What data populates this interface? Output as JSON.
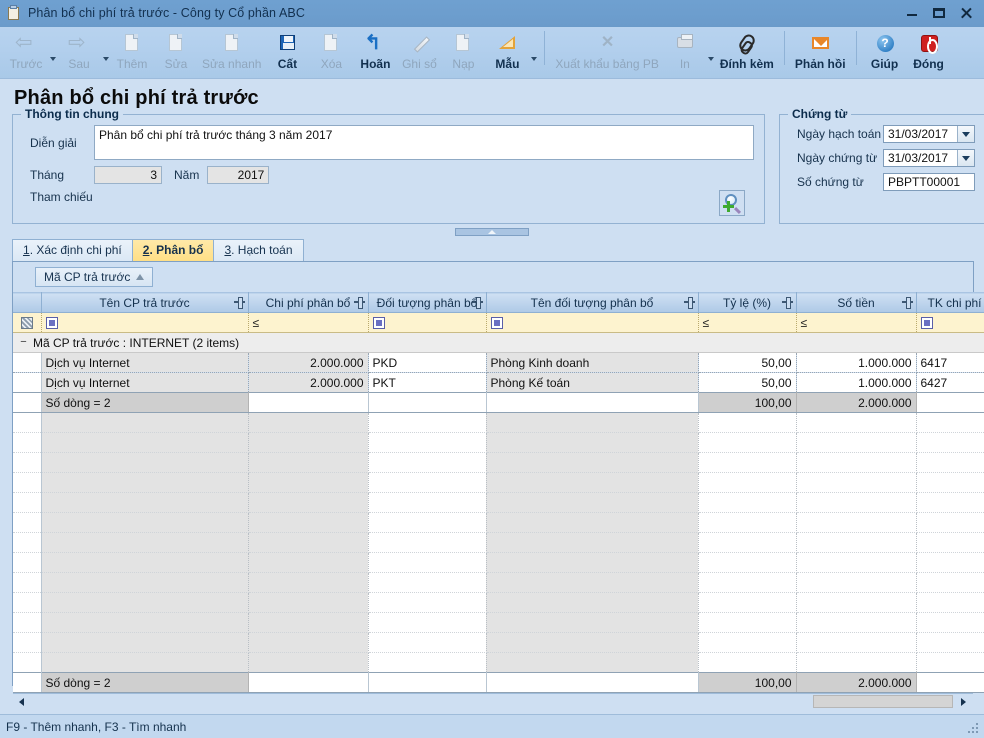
{
  "window": {
    "title": "Phân bổ chi phí trả trước - Công ty Cổ phần ABC",
    "minimize": "–",
    "maximize": "□",
    "close": "✕"
  },
  "toolbar": [
    {
      "label": "Trước",
      "icon": "back-arrow-icon",
      "disabled": true,
      "caret": true
    },
    {
      "label": "Sau",
      "icon": "forward-arrow-icon",
      "disabled": true,
      "caret": true
    },
    {
      "label": "Thêm",
      "icon": "add-document-icon",
      "disabled": true,
      "caret": false
    },
    {
      "label": "Sửa",
      "icon": "edit-document-icon",
      "disabled": true,
      "caret": false
    },
    {
      "label": "Sửa nhanh",
      "icon": "quick-edit-document-icon",
      "disabled": true,
      "caret": false
    },
    {
      "label": "Cất",
      "icon": "save-floppy-icon",
      "disabled": false,
      "caret": false
    },
    {
      "label": "Xóa",
      "icon": "delete-document-icon",
      "disabled": true,
      "caret": false
    },
    {
      "label": "Hoãn",
      "icon": "undo-arrow-icon",
      "disabled": false,
      "caret": false
    },
    {
      "label": "Ghi sổ",
      "icon": "pencil-icon",
      "disabled": true,
      "caret": false
    },
    {
      "label": "Nạp",
      "icon": "refresh-document-icon",
      "disabled": true,
      "caret": false
    },
    {
      "label": "Mẫu",
      "icon": "ruler-template-icon",
      "disabled": false,
      "caret": true
    },
    {
      "label": "Xuất khẩu bảng PB",
      "icon": "excel-export-icon",
      "disabled": true,
      "caret": false
    },
    {
      "label": "In",
      "icon": "printer-icon",
      "disabled": true,
      "caret": true
    },
    {
      "label": "Đính kèm",
      "icon": "paperclip-icon",
      "disabled": false,
      "caret": false
    },
    {
      "label": "Phản hồi",
      "icon": "mail-envelope-icon",
      "disabled": false,
      "caret": false
    },
    {
      "label": "Giúp",
      "icon": "help-circle-icon",
      "disabled": false,
      "caret": false
    },
    {
      "label": "Đóng",
      "icon": "power-close-icon",
      "disabled": false,
      "caret": false
    }
  ],
  "page": {
    "title": "Phân bổ chi phí trả trước"
  },
  "general": {
    "legend": "Thông tin chung",
    "description_label": "Diễn giải",
    "description_value": "Phân bổ chi phí trả trước tháng 3 năm 2017",
    "month_label": "Tháng",
    "month_value": "3",
    "year_label": "Năm",
    "year_value": "2017",
    "reference_label": "Tham chiếu",
    "reference_button_icon": "magnifier-add-icon"
  },
  "voucher": {
    "legend": "Chứng từ",
    "posting_date_label": "Ngày hạch toán",
    "posting_date_value": "31/03/2017",
    "voucher_date_label": "Ngày chứng từ",
    "voucher_date_value": "31/03/2017",
    "voucher_no_label": "Số chứng từ",
    "voucher_no_value": "PBPTT00001"
  },
  "tabs": [
    {
      "num": "1",
      "label": ". Xác định chi phí",
      "active": false
    },
    {
      "num": "2",
      "label": ". Phân bổ",
      "active": true
    },
    {
      "num": "3",
      "label": ". Hạch toán",
      "active": false
    }
  ],
  "grid": {
    "group_chip": "Mã CP trả trước",
    "columns": [
      {
        "header": "Tên CP trả trước",
        "filter": "checkbox",
        "align": "left"
      },
      {
        "header": "Chi phí phân bổ",
        "filter": "le",
        "align": "right"
      },
      {
        "header": "Đối tượng phân bổ",
        "filter": "checkbox",
        "align": "left"
      },
      {
        "header": "Tên đối tượng phân bổ",
        "filter": "checkbox",
        "align": "left"
      },
      {
        "header": "Tỷ lệ (%)",
        "filter": "le",
        "align": "right"
      },
      {
        "header": "Số tiền",
        "filter": "le",
        "align": "right"
      },
      {
        "header": "TK chi phí",
        "filter": "checkbox",
        "align": "left"
      }
    ],
    "group_header": "Mã CP trả trước : INTERNET (2 items)",
    "rows": [
      {
        "name": "Dịch vụ Internet",
        "cost": "2.000.000",
        "object_code": "PKD",
        "object_name": "Phòng Kinh doanh",
        "rate": "50,00",
        "amount": "1.000.000",
        "account": "6417"
      },
      {
        "name": "Dịch vụ Internet",
        "cost": "2.000.000",
        "object_code": "PKT",
        "object_name": "Phòng Kế toán",
        "rate": "50,00",
        "amount": "1.000.000",
        "account": "6427"
      }
    ],
    "group_summary": {
      "label": "Số dòng = 2",
      "rate": "100,00",
      "amount": "2.000.000"
    },
    "grand_summary": {
      "label": "Số dòng = 2",
      "rate": "100,00",
      "amount": "2.000.000"
    }
  },
  "status": {
    "hint": "F9 - Thêm nhanh, F3 - Tìm nhanh"
  },
  "colors": {
    "window_bg": "#cedff2",
    "titlebar": "#6d9ece",
    "tab_active": "#ffdf86",
    "filter_row": "#fdf3cf",
    "grid_shade": "#e3e3e3",
    "summary_row": "#cfcfcf"
  }
}
